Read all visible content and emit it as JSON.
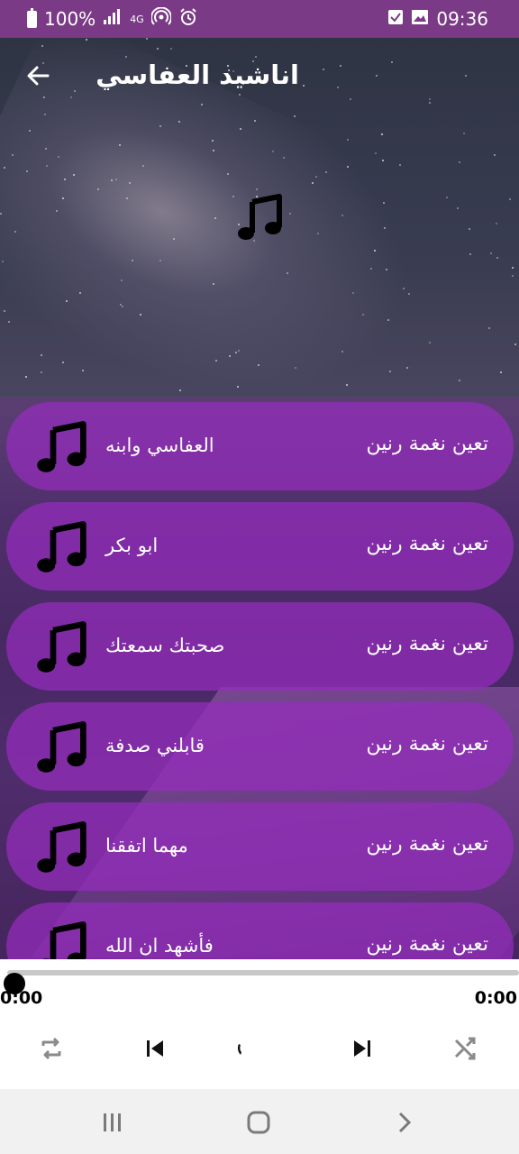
{
  "status_bar": {
    "battery_text": "100%",
    "network_text": "4G",
    "time": "09:36",
    "background": "#7a3a86"
  },
  "header": {
    "title": "اناشيد العفاسي"
  },
  "list": {
    "action_label": "تعين نغمة رنين",
    "items": [
      {
        "title": "العفاسي وابنه"
      },
      {
        "title": "ابو بكر"
      },
      {
        "title": "صحبتك سمعتك"
      },
      {
        "title": "قابلني صدفة"
      },
      {
        "title": "مهما اتفقنا"
      },
      {
        "title": "فأشهد ان الله"
      }
    ]
  },
  "player": {
    "time_start": "0:00",
    "time_end": "0:00",
    "progress": 0
  },
  "colors": {
    "accent": "#962dbe",
    "overlay": "#783296"
  },
  "icons": {
    "back": "arrow-left-icon",
    "note": "music-note-icon",
    "repeat": "repeat-icon",
    "previous": "skip-previous-icon",
    "play": "play-icon",
    "next": "skip-next-icon",
    "shuffle": "shuffle-icon"
  }
}
